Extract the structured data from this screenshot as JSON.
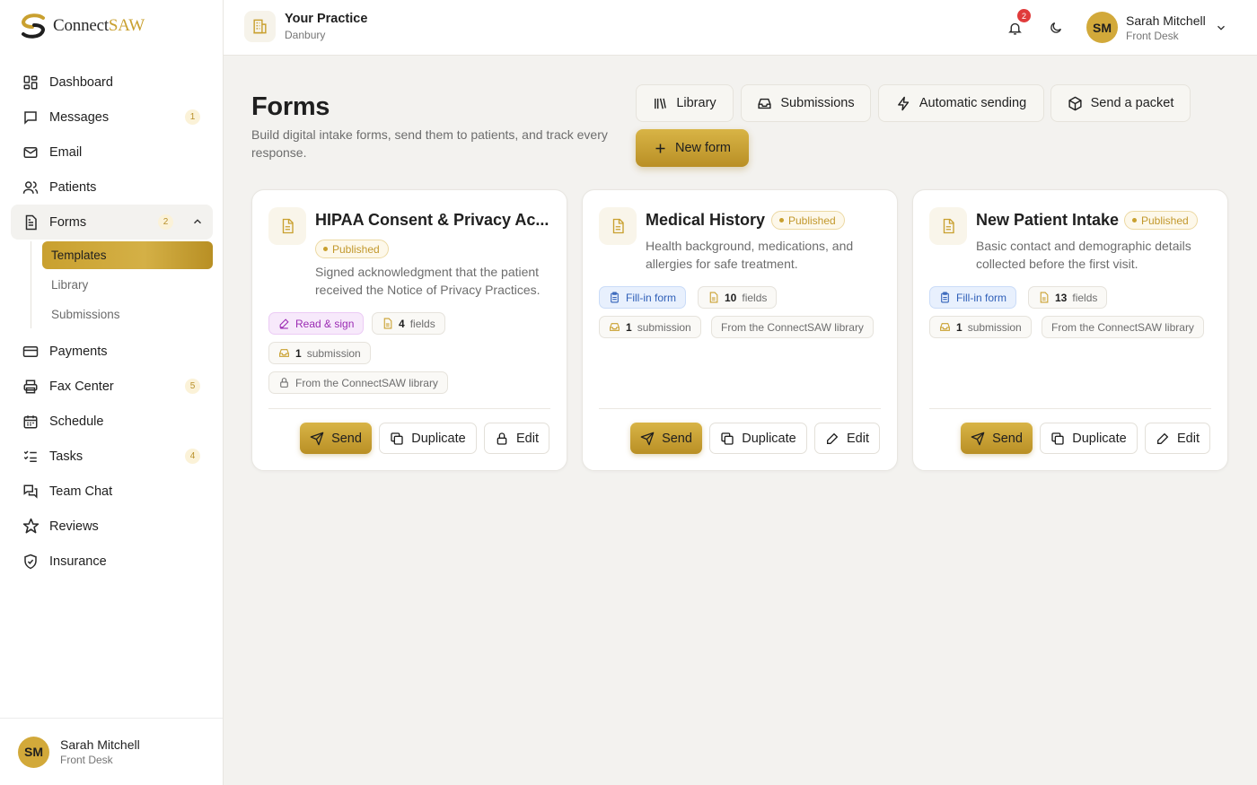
{
  "brand": {
    "name_part1": "Connect",
    "name_part2": "SAW",
    "accent_color": "#c9a02f"
  },
  "sidebar": {
    "items": [
      {
        "label": "Dashboard",
        "icon": "dashboard-icon",
        "badge": ""
      },
      {
        "label": "Messages",
        "icon": "message-icon",
        "badge": "1"
      },
      {
        "label": "Email",
        "icon": "mail-icon",
        "badge": ""
      },
      {
        "label": "Patients",
        "icon": "users-icon",
        "badge": ""
      },
      {
        "label": "Forms",
        "icon": "document-icon",
        "badge": "2"
      },
      {
        "label": "Payments",
        "icon": "credit-card-icon",
        "badge": ""
      },
      {
        "label": "Fax Center",
        "icon": "printer-icon",
        "badge": "5"
      },
      {
        "label": "Schedule",
        "icon": "calendar-icon",
        "badge": ""
      },
      {
        "label": "Tasks",
        "icon": "checklist-icon",
        "badge": "4"
      },
      {
        "label": "Team Chat",
        "icon": "chat-icon",
        "badge": ""
      },
      {
        "label": "Reviews",
        "icon": "star-icon",
        "badge": ""
      },
      {
        "label": "Insurance",
        "icon": "shield-icon",
        "badge": ""
      }
    ],
    "forms_sub": [
      "Templates",
      "Library",
      "Submissions"
    ],
    "user": {
      "initials": "SM",
      "name": "Sarah Mitchell",
      "role": "Front Desk"
    }
  },
  "header": {
    "practice_name": "Your Practice",
    "practice_location": "Danbury",
    "notification_count": "2",
    "user": {
      "initials": "SM",
      "name": "Sarah Mitchell",
      "role": "Front Desk"
    }
  },
  "page": {
    "title": "Forms",
    "subtitle": "Build digital intake forms, send them to patients, and track every response.",
    "toolbar": {
      "library": "Library",
      "submissions": "Submissions",
      "automatic_sending": "Automatic sending",
      "send_packet": "Send a packet",
      "new_form": "New form"
    }
  },
  "cards": [
    {
      "title": "HIPAA Consent & Privacy Ac...",
      "status": "Published",
      "description": "Signed acknowledgment that the patient received the Notice of Privacy Practices.",
      "mode": "Read & sign",
      "fields_count": "4",
      "fields_label": "fields",
      "submissions_count": "1",
      "submissions_label": "submission",
      "source": "From the ConnectSAW library",
      "actions": {
        "send": "Send",
        "duplicate": "Duplicate",
        "edit": "Edit"
      }
    },
    {
      "title": "Medical History",
      "status": "Published",
      "description": "Health background, medications, and allergies for safe treatment.",
      "mode": "Fill-in form",
      "fields_count": "10",
      "fields_label": "fields",
      "submissions_count": "1",
      "submissions_label": "submission",
      "source": "From the ConnectSAW library",
      "actions": {
        "send": "Send",
        "duplicate": "Duplicate",
        "edit": "Edit"
      }
    },
    {
      "title": "New Patient Intake",
      "status": "Published",
      "description": "Basic contact and demographic details collected before the first visit.",
      "mode": "Fill-in form",
      "fields_count": "13",
      "fields_label": "fields",
      "submissions_count": "1",
      "submissions_label": "submission",
      "source": "From the ConnectSAW library",
      "actions": {
        "send": "Send",
        "duplicate": "Duplicate",
        "edit": "Edit"
      }
    }
  ]
}
